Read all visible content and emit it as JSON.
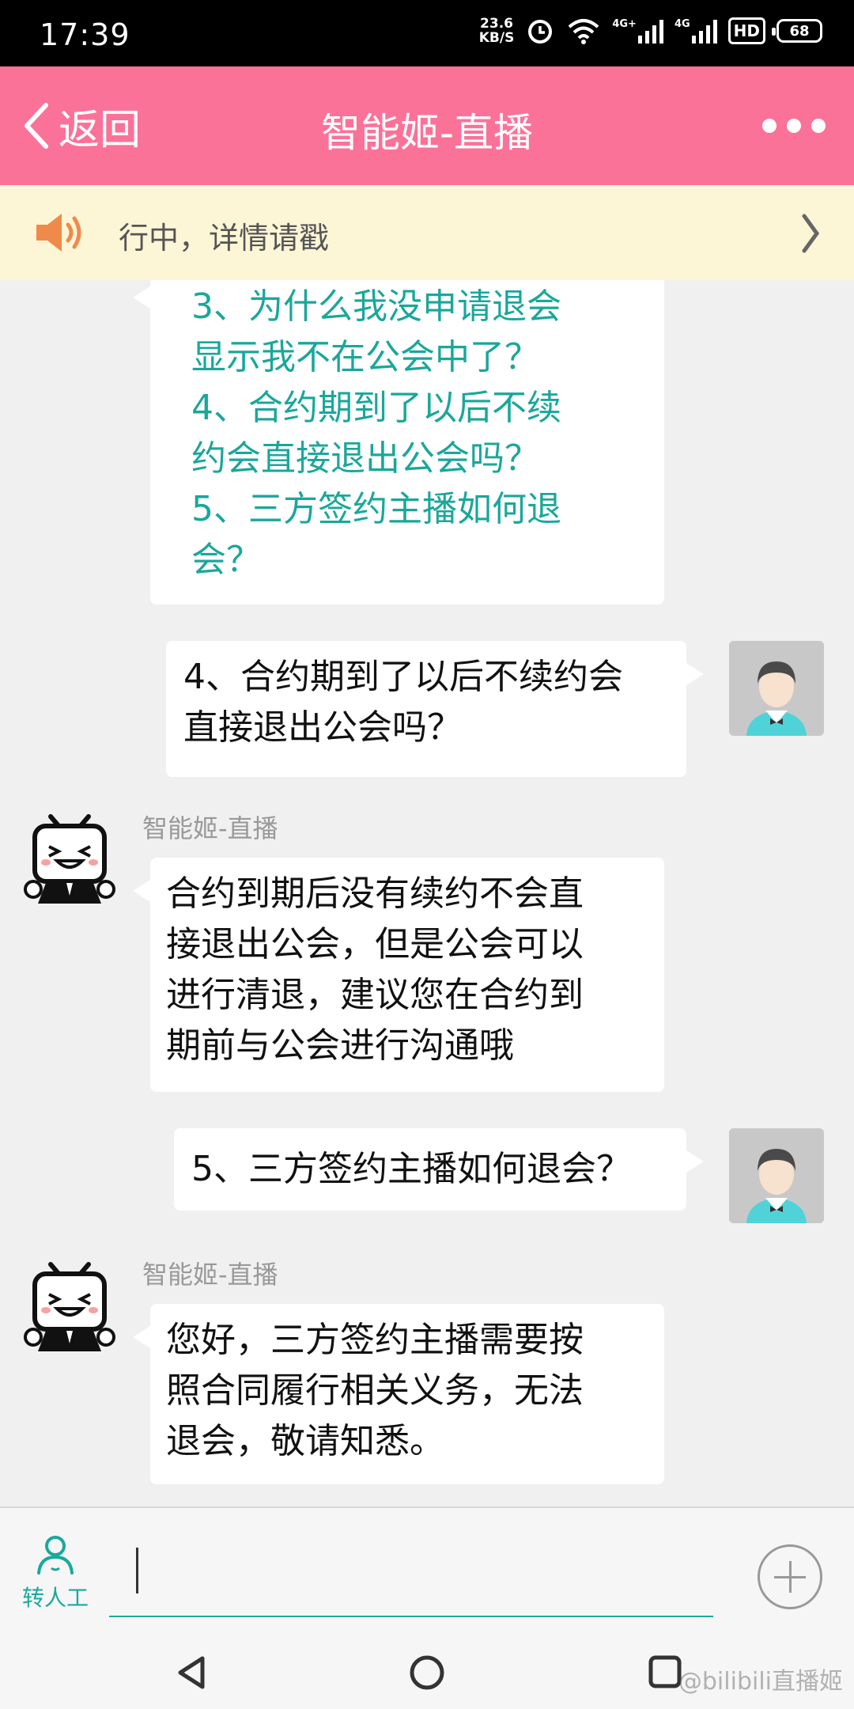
{
  "status_bar": {
    "time": "17:39",
    "net_speed_value": "23.6",
    "net_speed_unit": "KB/S",
    "signal_1_label": "4G+",
    "signal_2_label": "4G",
    "hd_label": "HD",
    "battery": "68",
    "icons": [
      "alarm-icon",
      "wifi-icon",
      "signal-icon",
      "hd-icon",
      "battery-icon"
    ]
  },
  "header": {
    "back_label": "返回",
    "title": "智能姬-直播",
    "more_icon": "more-dots-icon",
    "background": "#fb7299"
  },
  "notice": {
    "text": "行中，详情请戳",
    "icon": "speaker-icon"
  },
  "messages": {
    "faq_questions": [
      "3、为什么我没申请退会",
      "显示我不在公会中了？",
      "4、合约期到了以后不续",
      "约会直接退出公会吗？",
      "5、三方签约主播如何退",
      "会？"
    ],
    "user_1_lines": [
      "4、合约期到了以后不续约会",
      "直接退出公会吗？"
    ],
    "bot_1_sender": "智能姬-直播",
    "bot_1_lines": [
      "合约到期后没有续约不会直",
      "接退出公会，但是公会可以",
      "进行清退，建议您在合约到",
      "期前与公会进行沟通哦"
    ],
    "user_2_text": "5、三方签约主播如何退会？",
    "bot_2_sender": "智能姬-直播",
    "bot_2_lines": [
      "您好，三方签约主播需要按",
      "照合同履行相关义务，无法",
      "退会，敬请知悉。"
    ],
    "link_color": "#1aa79a"
  },
  "input_bar": {
    "transfer_label": "转人工",
    "transfer_icon": "person-icon",
    "add_icon": "plus-icon"
  },
  "nav": {
    "icons": [
      "back-triangle-icon",
      "home-circle-icon",
      "recents-square-icon"
    ],
    "watermark": "@bilibili直播姬"
  }
}
